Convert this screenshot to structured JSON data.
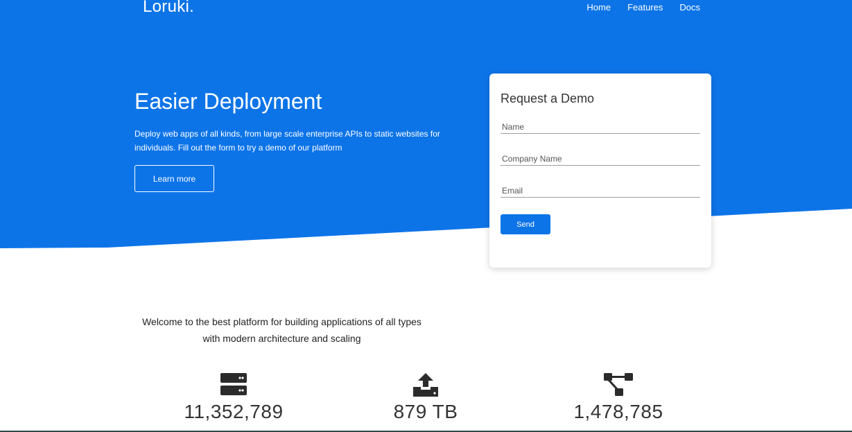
{
  "colors": {
    "primary": "#0d74e8",
    "white": "#ffffff",
    "text": "#333333"
  },
  "header": {
    "brand": "Loruki.",
    "nav": [
      {
        "label": "Home"
      },
      {
        "label": "Features"
      },
      {
        "label": "Docs"
      }
    ]
  },
  "hero": {
    "title": "Easier Deployment",
    "description": "Deploy web apps of all kinds, from large scale enterprise APIs to static websites for individuals. Fill out the form to try a demo of our platform",
    "learn_more_label": "Learn more"
  },
  "demo_form": {
    "title": "Request a Demo",
    "name_placeholder": "Name",
    "company_placeholder": "Company Name",
    "email_placeholder": "Email",
    "send_label": "Send"
  },
  "welcome": {
    "text": "Welcome to the best platform for building applications of all types with modern architecture and scaling"
  },
  "stats": [
    {
      "icon": "server-icon",
      "value": "11,352,789"
    },
    {
      "icon": "upload-icon",
      "value": "879 TB"
    },
    {
      "icon": "network-icon",
      "value": "1,478,785"
    }
  ]
}
